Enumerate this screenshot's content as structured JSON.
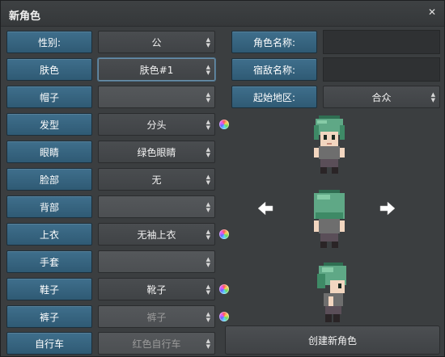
{
  "window": {
    "title": "新角色",
    "close_glyph": "✕"
  },
  "left_rows": [
    {
      "label": "性别:",
      "value": "公",
      "state": "normal",
      "color_picker": false
    },
    {
      "label": "肤色",
      "value": "肤色#1",
      "state": "active",
      "color_picker": false
    },
    {
      "label": "帽子",
      "value": "",
      "state": "disabled",
      "color_picker": false
    },
    {
      "label": "发型",
      "value": "分头",
      "state": "normal",
      "color_picker": true
    },
    {
      "label": "眼睛",
      "value": "绿色眼睛",
      "state": "normal",
      "color_picker": false
    },
    {
      "label": "脸部",
      "value": "无",
      "state": "normal",
      "color_picker": false
    },
    {
      "label": "背部",
      "value": "",
      "state": "disabled",
      "color_picker": false
    },
    {
      "label": "上衣",
      "value": "无袖上衣",
      "state": "normal",
      "color_picker": true
    },
    {
      "label": "手套",
      "value": "",
      "state": "disabled",
      "color_picker": false
    },
    {
      "label": "鞋子",
      "value": "靴子",
      "state": "normal",
      "color_picker": true
    },
    {
      "label": "裤子",
      "value": "裤子",
      "state": "disabled",
      "color_picker": true
    },
    {
      "label": "自行车",
      "value": "红色自行车",
      "state": "disabled",
      "color_picker": false
    }
  ],
  "right_form": {
    "name_label": "角色名称:",
    "name_value": "",
    "rival_label": "宿敌名称:",
    "rival_value": "",
    "region_label": "起始地区:",
    "region_value": "合众"
  },
  "preview": {
    "rotate_left_icon": "arrow-left-icon",
    "rotate_right_icon": "arrow-right-icon",
    "hair_color": "#5fa886",
    "skin_color": "#f2d6c0",
    "top_color": "#6e6e6e",
    "pants_color": "#5a4e58"
  },
  "actions": {
    "create_label": "创建新角色"
  },
  "colors": {
    "label_bg": "#356480",
    "window_bg": "#3b3e40"
  }
}
